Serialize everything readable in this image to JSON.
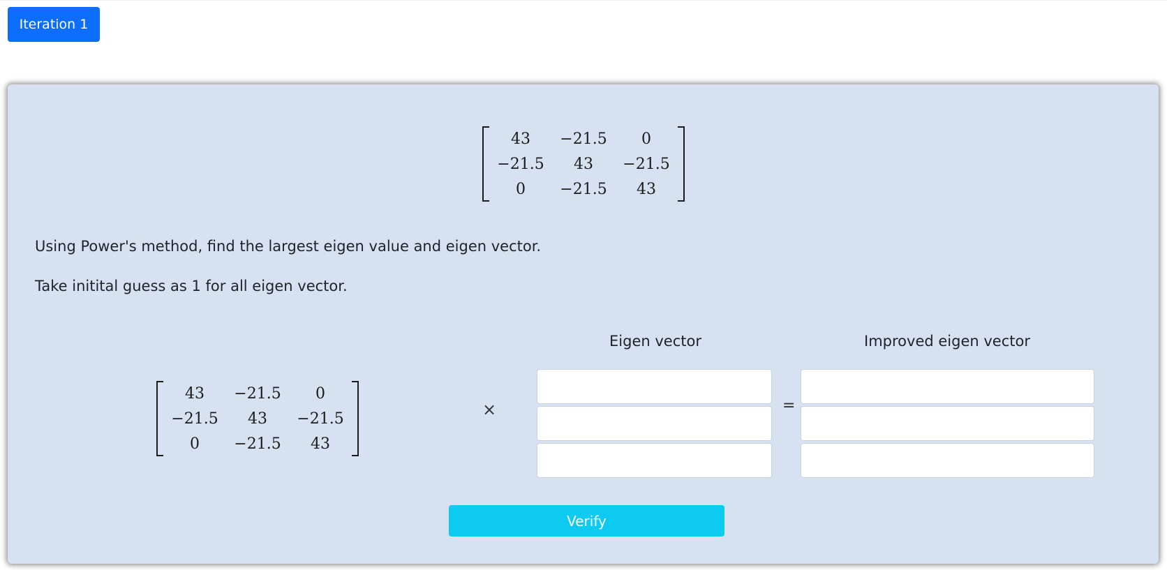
{
  "tabs": [
    {
      "label": "Iteration 1"
    }
  ],
  "matrix": [
    [
      "43",
      "−21.5",
      "0"
    ],
    [
      "−21.5",
      "43",
      "−21.5"
    ],
    [
      "0",
      "−21.5",
      "43"
    ]
  ],
  "question": {
    "line1": "Using Power's method, find the largest eigen value and eigen vector.",
    "line2": "Take initital guess as 1 for all eigen vector."
  },
  "operators": {
    "times": "×",
    "equals": "="
  },
  "headers": {
    "eigen_vector": "Eigen vector",
    "improved_eigen_vector": "Improved eigen vector"
  },
  "eigen_vector_inputs": [
    {
      "value": ""
    },
    {
      "value": ""
    },
    {
      "value": ""
    }
  ],
  "improved_vector_inputs": [
    {
      "value": ""
    },
    {
      "value": ""
    },
    {
      "value": ""
    }
  ],
  "verify_label": "Verify",
  "colors": {
    "primary": "#0d6efd",
    "info": "#0dcaf0",
    "panel": "#d6e1f2"
  }
}
